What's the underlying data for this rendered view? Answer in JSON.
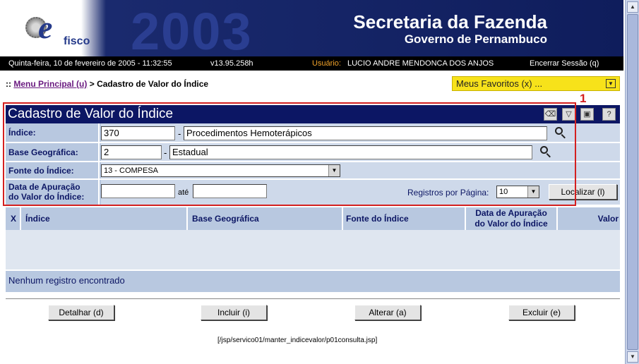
{
  "header": {
    "brand_logo_text": "fisco",
    "watermark_year": "2003",
    "title": "Secretaria da Fazenda",
    "subtitle": "Governo de Pernambuco"
  },
  "infobar": {
    "datetime": "Quinta-feira, 10 de fevereiro de 2005 - 11:32:55",
    "version": "v13.95.258h",
    "user_label": "Usuário:",
    "user_name": "LUCIO ANDRE MENDONCA DOS ANJOS",
    "logout": "Encerrar Sessão (q)"
  },
  "breadcrumb": {
    "prefix": "::",
    "home_link": "Menu Principal (u)",
    "separator": ">",
    "current": "Cadastro de Valor do Índice"
  },
  "favorites": {
    "label": "Meus Favoritos (x) ..."
  },
  "annotation": {
    "number": "1"
  },
  "form": {
    "title": "Cadastro de Valor do Índice",
    "indice": {
      "label": "Índice:",
      "code": "370",
      "description": "Procedimentos Hemoterápicos"
    },
    "base": {
      "label": "Base Geográfica:",
      "code": "2",
      "description": "Estadual"
    },
    "fonte": {
      "label": "Fonte do Índice:",
      "selected": "13 - COMPESA"
    },
    "data": {
      "label_line1": "Data de Apuração",
      "label_line2": "do Valor do Índice:",
      "from": "",
      "to_label": "até",
      "to": ""
    },
    "per_page": {
      "label": "Registros por Página:",
      "selected": "10"
    },
    "search_button": "Localizar (l)",
    "dash": "-"
  },
  "table": {
    "columns": [
      "X",
      "Índice",
      "Base Geográfica",
      "Fonte do Índice",
      "Data de Apuração",
      "do Valor do Índice",
      "Valor"
    ],
    "empty_message": "Nenhum registro encontrado"
  },
  "actions": {
    "detail": "Detalhar (d)",
    "include": "Incluir (i)",
    "alter": "Alterar (a)",
    "delete": "Excluir (e)"
  },
  "footer": {
    "path": "[/jsp/servico01/manter_indicevalor/p01consulta.jsp]"
  },
  "colors": {
    "panel_header": "#0c1664",
    "label_bg": "#b8c8e0",
    "annotation": "#d42020",
    "favorites": "#f7e21a"
  }
}
